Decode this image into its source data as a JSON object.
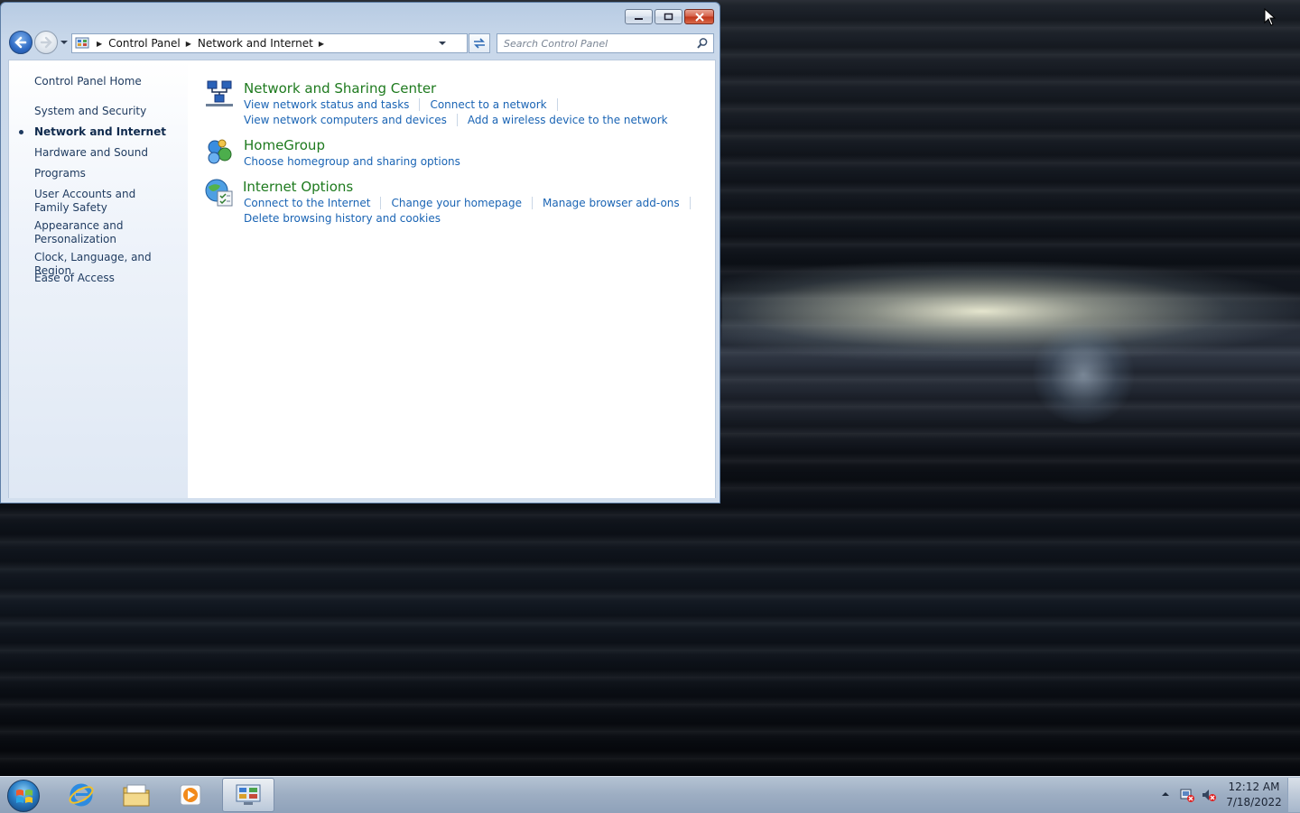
{
  "window": {
    "breadcrumb": [
      "Control Panel",
      "Network and Internet"
    ],
    "search_placeholder": "Search Control Panel"
  },
  "sidebar": {
    "home": "Control Panel Home",
    "items": [
      {
        "label": "System and Security"
      },
      {
        "label": "Network and Internet",
        "current": true
      },
      {
        "label": "Hardware and Sound"
      },
      {
        "label": "Programs"
      },
      {
        "label": "User Accounts and Family Safety"
      },
      {
        "label": "Appearance and Personalization"
      },
      {
        "label": "Clock, Language, and Region"
      },
      {
        "label": "Ease of Access"
      }
    ]
  },
  "categories": [
    {
      "title": "Network and Sharing Center",
      "icon": "network-sharing-icon",
      "tasks": [
        [
          "View network status and tasks",
          "Connect to a network"
        ],
        [
          "View network computers and devices",
          "Add a wireless device to the network"
        ]
      ]
    },
    {
      "title": "HomeGroup",
      "icon": "homegroup-icon",
      "tasks": [
        [
          "Choose homegroup and sharing options"
        ]
      ]
    },
    {
      "title": "Internet Options",
      "icon": "internet-options-icon",
      "tasks": [
        [
          "Connect to the Internet",
          "Change your homepage",
          "Manage browser add-ons"
        ],
        [
          "Delete browsing history and cookies"
        ]
      ]
    }
  ],
  "taskbar": {
    "pinned": [
      "internet-explorer-icon",
      "windows-explorer-icon",
      "media-player-icon",
      "control-panel-icon"
    ],
    "clock_time": "12:12 AM",
    "clock_date": "7/18/2022"
  },
  "colors": {
    "link": "#1a64b4",
    "category_title": "#1e7a1e",
    "close_button": "#c03419"
  }
}
